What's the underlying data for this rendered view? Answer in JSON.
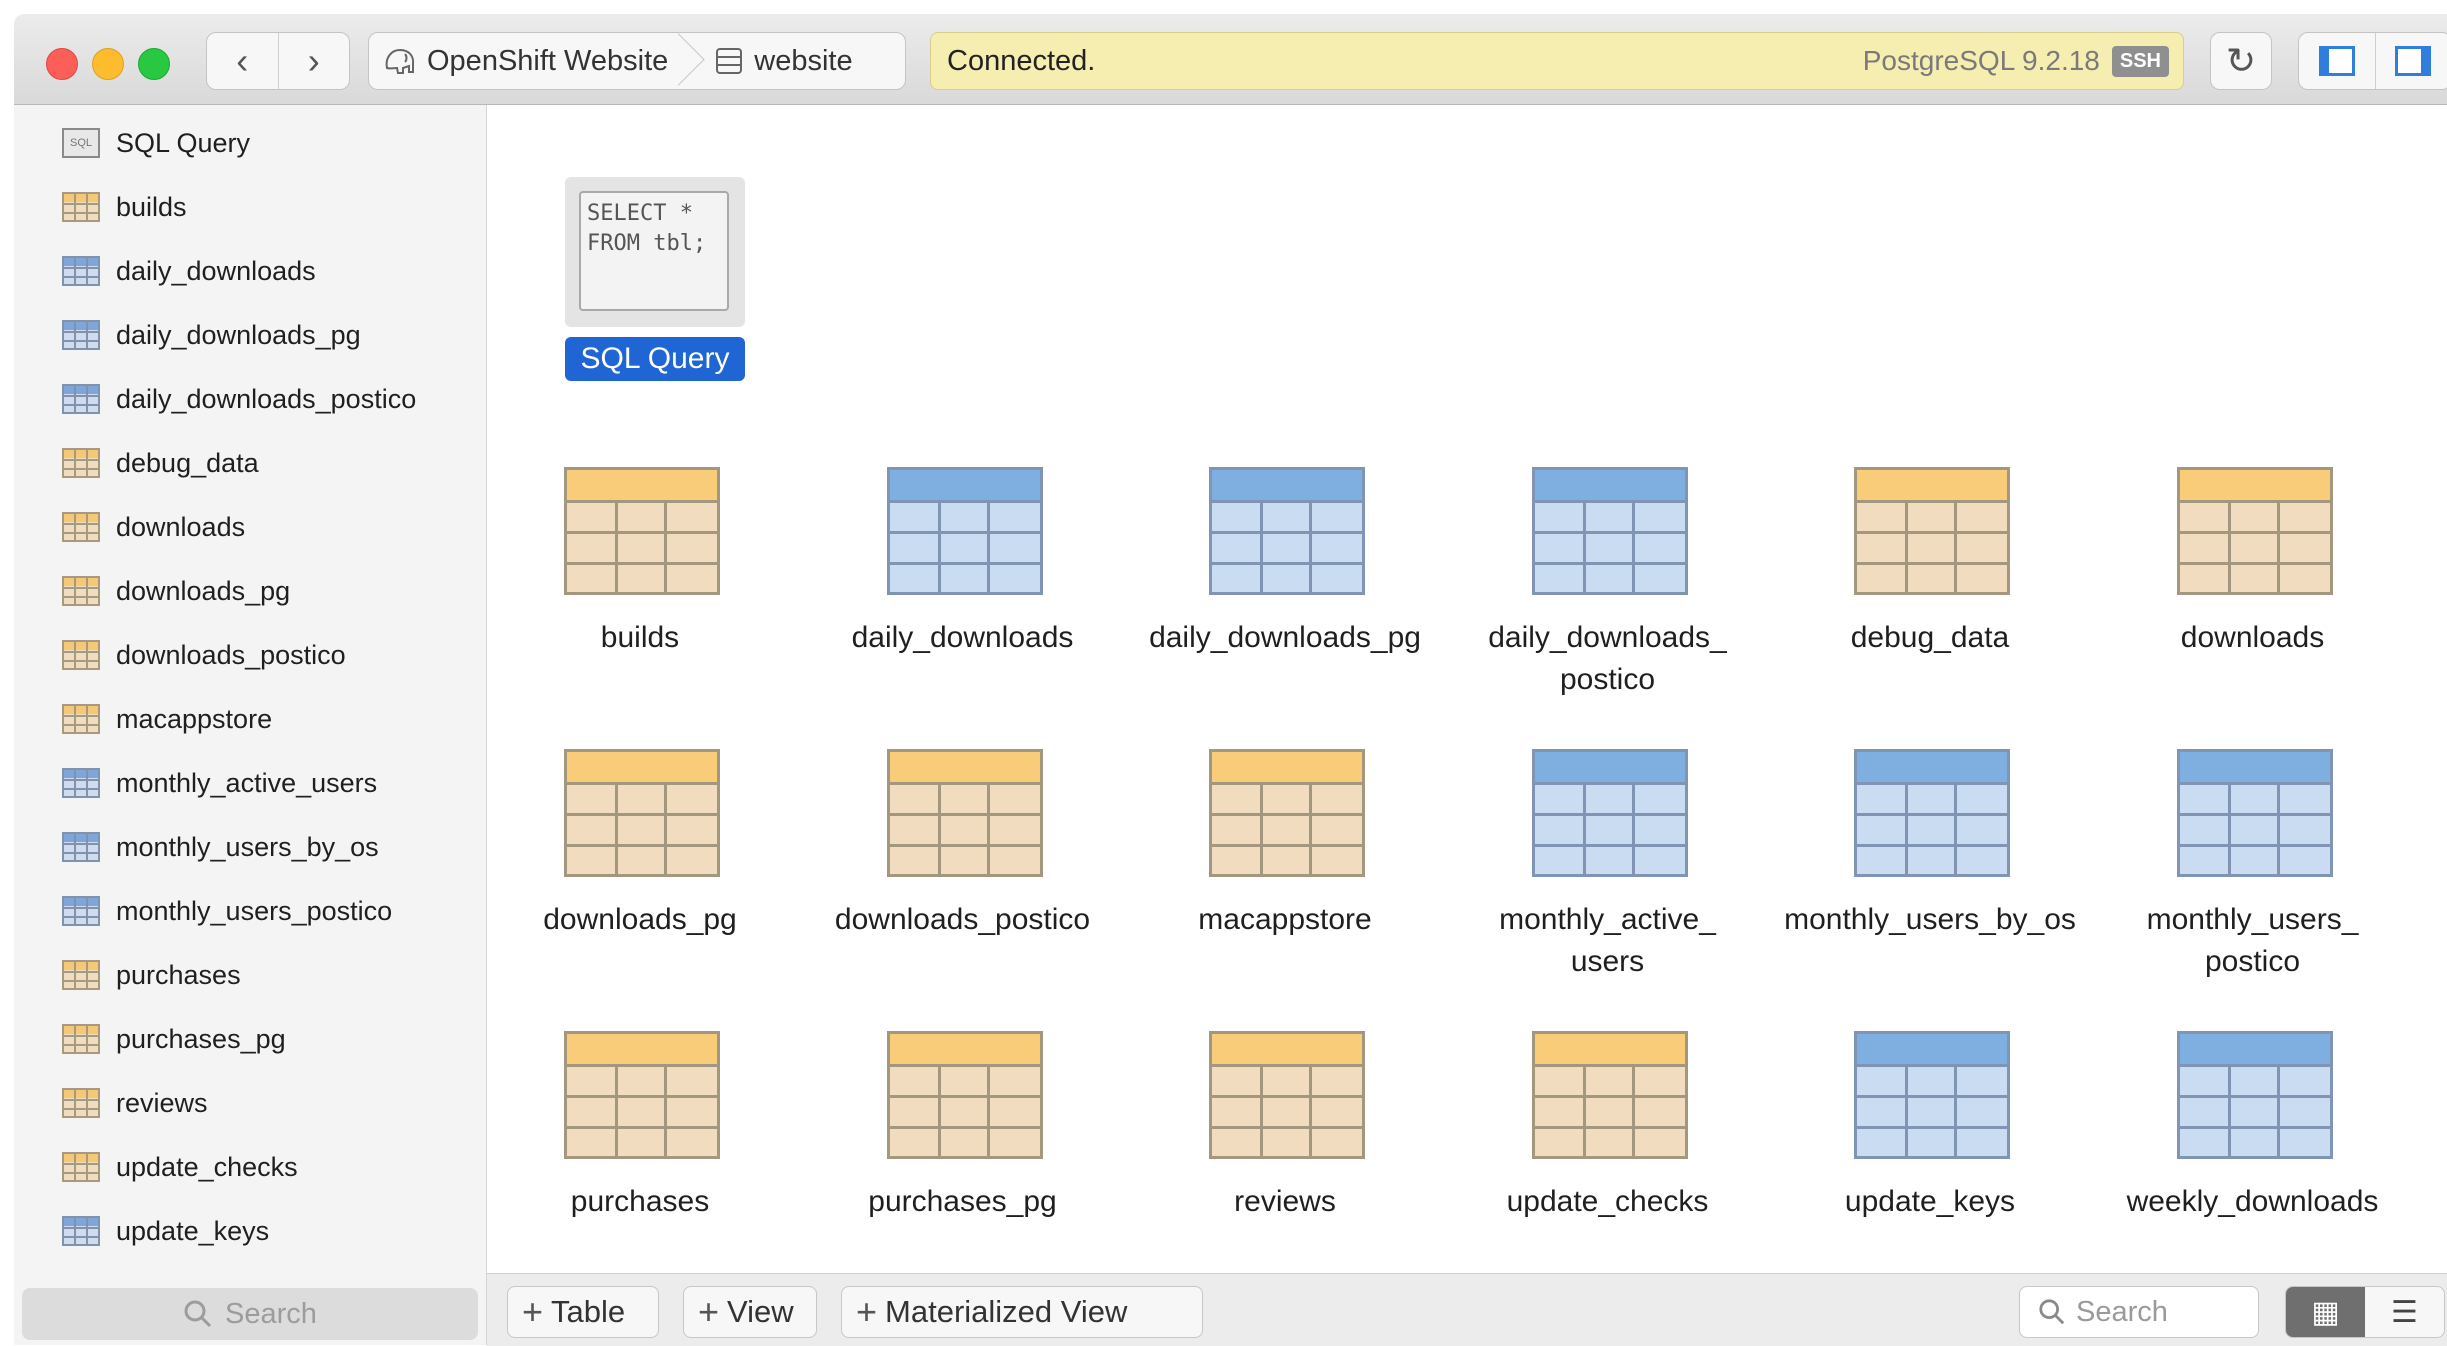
{
  "titlebar": {
    "breadcrumb": {
      "server": "OpenShift Website",
      "database": "website"
    },
    "status": {
      "text": "Connected.",
      "server_version": "PostgreSQL 9.2.18",
      "badge": "SSH"
    },
    "icons": {
      "back": "‹",
      "forward": "›",
      "reload": "↻"
    }
  },
  "sidebar": {
    "items": [
      {
        "label": "SQL Query",
        "kind": "sql"
      },
      {
        "label": "builds",
        "kind": "table"
      },
      {
        "label": "daily_downloads",
        "kind": "view"
      },
      {
        "label": "daily_downloads_pg",
        "kind": "view"
      },
      {
        "label": "daily_downloads_postico",
        "kind": "view"
      },
      {
        "label": "debug_data",
        "kind": "table"
      },
      {
        "label": "downloads",
        "kind": "table"
      },
      {
        "label": "downloads_pg",
        "kind": "table"
      },
      {
        "label": "downloads_postico",
        "kind": "table"
      },
      {
        "label": "macappstore",
        "kind": "table"
      },
      {
        "label": "monthly_active_users",
        "kind": "view"
      },
      {
        "label": "monthly_users_by_os",
        "kind": "view"
      },
      {
        "label": "monthly_users_postico",
        "kind": "view"
      },
      {
        "label": "purchases",
        "kind": "table"
      },
      {
        "label": "purchases_pg",
        "kind": "table"
      },
      {
        "label": "reviews",
        "kind": "table"
      },
      {
        "label": "update_checks",
        "kind": "table"
      },
      {
        "label": "update_keys",
        "kind": "view"
      }
    ],
    "search_placeholder": "Search"
  },
  "main": {
    "sql_query": {
      "code": "SELECT *\nFROM tbl;",
      "label": "SQL Query"
    },
    "tiles": [
      {
        "label": "builds",
        "kind": "table"
      },
      {
        "label": "daily_downloads",
        "kind": "view"
      },
      {
        "label": "daily_downloads_pg",
        "kind": "view"
      },
      {
        "label": "daily_downloads_\npostico",
        "kind": "view"
      },
      {
        "label": "debug_data",
        "kind": "table"
      },
      {
        "label": "downloads",
        "kind": "table"
      },
      {
        "label": "downloads_pg",
        "kind": "table"
      },
      {
        "label": "downloads_postico",
        "kind": "table"
      },
      {
        "label": "macappstore",
        "kind": "table"
      },
      {
        "label": "monthly_active_\nusers",
        "kind": "view"
      },
      {
        "label": "monthly_users_by_os",
        "kind": "view"
      },
      {
        "label": "monthly_users_\npostico",
        "kind": "view"
      },
      {
        "label": "purchases",
        "kind": "table"
      },
      {
        "label": "purchases_pg",
        "kind": "table"
      },
      {
        "label": "reviews",
        "kind": "table"
      },
      {
        "label": "update_checks",
        "kind": "table"
      },
      {
        "label": "update_keys",
        "kind": "view"
      },
      {
        "label": "weekly_downloads",
        "kind": "view"
      }
    ]
  },
  "bottombar": {
    "add_table": "Table",
    "add_view": "View",
    "add_materialized_view": "Materialized View",
    "search_placeholder": "Search",
    "view_grid_icon": "▦",
    "view_list_icon": "☰"
  },
  "colors": {
    "table_header": "#f8cc78",
    "view_header": "#7faee0",
    "selection": "#1f66d4",
    "status_bar": "#f6edb0"
  }
}
